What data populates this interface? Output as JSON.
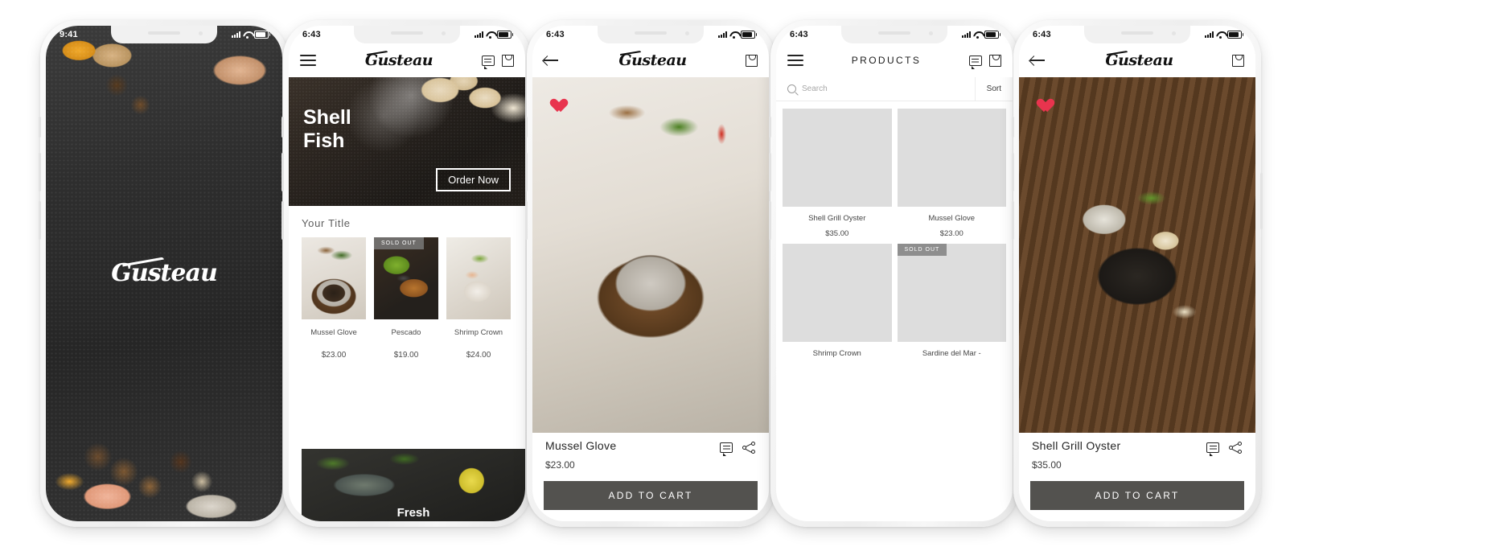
{
  "brand": "Gusteau",
  "phones": [
    {
      "id": "splash",
      "status": {
        "time": "9:41"
      },
      "screen_type": "splash",
      "logo": "Gusteau"
    },
    {
      "id": "home",
      "status": {
        "time": "6:43"
      },
      "screen_type": "home",
      "appbar": {
        "menu_icon": "hamburger-icon",
        "chat_icon": "chat-icon",
        "bag_icon": "shopping-bag-icon"
      },
      "hero": {
        "line1": "Shell",
        "line2": "Fish",
        "cta": "Order Now"
      },
      "section_title": "Your Title",
      "products": [
        {
          "name": "Mussel Glove",
          "price": "$23.00",
          "badge": "",
          "thumb": "f-mussel"
        },
        {
          "name": "Pescado",
          "price": "$19.00",
          "badge": "SOLD OUT",
          "thumb": "f-pescado"
        },
        {
          "name": "Shrimp Crown",
          "price": "$24.00",
          "badge": "",
          "thumb": "f-shrimp"
        }
      ],
      "bottom_banner": {
        "caption": "Fresh"
      }
    },
    {
      "id": "detail-mussel",
      "status": {
        "time": "6:43"
      },
      "screen_type": "detail",
      "appbar": {
        "back_icon": "back-arrow-icon",
        "bag_icon": "shopping-bag-icon"
      },
      "favorite_icon": "heart-icon",
      "product": {
        "name": "Mussel Glove",
        "price": "$23.00"
      },
      "detail_icons": {
        "chat": "chat-icon",
        "share": "share-icon"
      },
      "cart_button": "ADD TO CART"
    },
    {
      "id": "products",
      "status": {
        "time": "6:43"
      },
      "screen_type": "grid",
      "appbar": {
        "menu_icon": "hamburger-icon",
        "title": "PRODUCTS",
        "chat_icon": "chat-icon",
        "bag_icon": "shopping-bag-icon"
      },
      "search": {
        "placeholder": "Search",
        "icon": "search-icon",
        "sort_label": "Sort"
      },
      "products": [
        {
          "name": "Shell Grill Oyster",
          "price": "$35.00",
          "badge": "",
          "thumb": "f-oyster"
        },
        {
          "name": "Mussel Glove",
          "price": "$23.00",
          "badge": "",
          "thumb": "f-mussel"
        },
        {
          "name": "Shrimp Crown",
          "price": "",
          "badge": "",
          "thumb": "f-crown"
        },
        {
          "name": "Sardine del Mar -",
          "price": "",
          "badge": "SOLD OUT",
          "thumb": "f-sardine"
        }
      ]
    },
    {
      "id": "detail-oyster",
      "status": {
        "time": "6:43"
      },
      "screen_type": "detail",
      "appbar": {
        "back_icon": "back-arrow-icon",
        "bag_icon": "shopping-bag-icon"
      },
      "favorite_icon": "heart-icon",
      "product": {
        "name": "Shell Grill Oyster",
        "price": "$35.00"
      },
      "detail_icons": {
        "chat": "chat-icon",
        "share": "share-icon"
      },
      "cart_button": "ADD TO CART"
    }
  ],
  "colors": {
    "accent_heart": "#e8344e",
    "cart_button": "#53524f",
    "text": "#242424",
    "muted": "#9b9b9b"
  }
}
